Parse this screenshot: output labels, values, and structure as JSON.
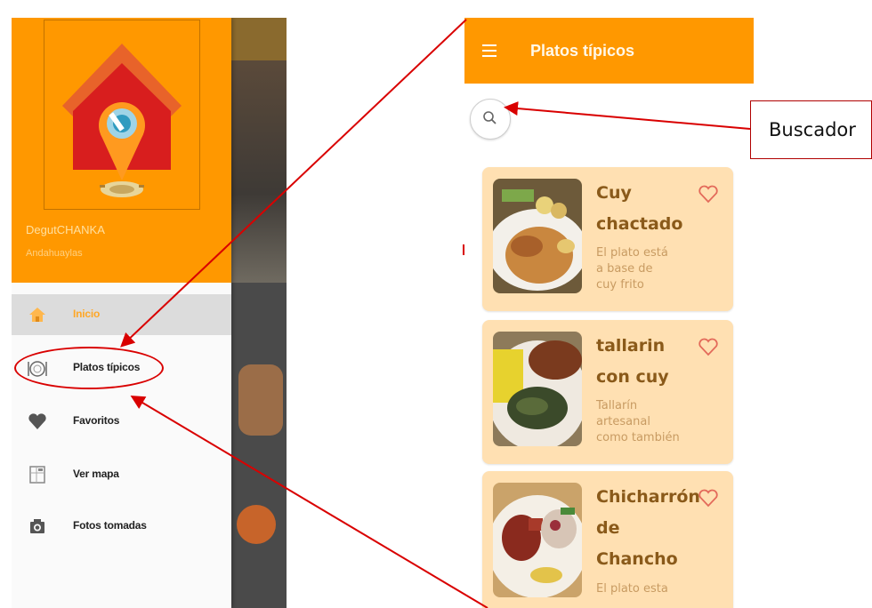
{
  "drawer": {
    "app_name": "DegutCHANKA",
    "location": "Andahuaylas",
    "items": [
      {
        "label": "Inicio",
        "icon": "home-icon",
        "active": true
      },
      {
        "label": "Platos típicos",
        "icon": "dish-icon",
        "active": false
      },
      {
        "label": "Favoritos",
        "icon": "heart-icon",
        "active": false
      },
      {
        "label": "Ver mapa",
        "icon": "map-icon",
        "active": false
      },
      {
        "label": "Fotos tomadas",
        "icon": "camera-icon",
        "active": false
      }
    ]
  },
  "main": {
    "title": "Platos típicos",
    "search_icon": "search-icon",
    "cards": [
      {
        "name_lines": [
          "Cuy",
          "chactado"
        ],
        "desc_lines": [
          "El plato está",
          "a base de",
          "cuy frito"
        ]
      },
      {
        "name_lines": [
          "tallarin",
          "con cuy"
        ],
        "desc_lines": [
          "Tallarín",
          "artesanal",
          "como también"
        ]
      },
      {
        "name_lines": [
          "Chicharrón",
          "de",
          "Chancho"
        ],
        "desc_lines": [
          "El plato esta"
        ]
      }
    ]
  },
  "annotation": {
    "callout_label": "Buscador"
  },
  "colors": {
    "primary": "#ff9800",
    "card_bg": "#ffe0b2",
    "annotation_red": "#d90000"
  }
}
